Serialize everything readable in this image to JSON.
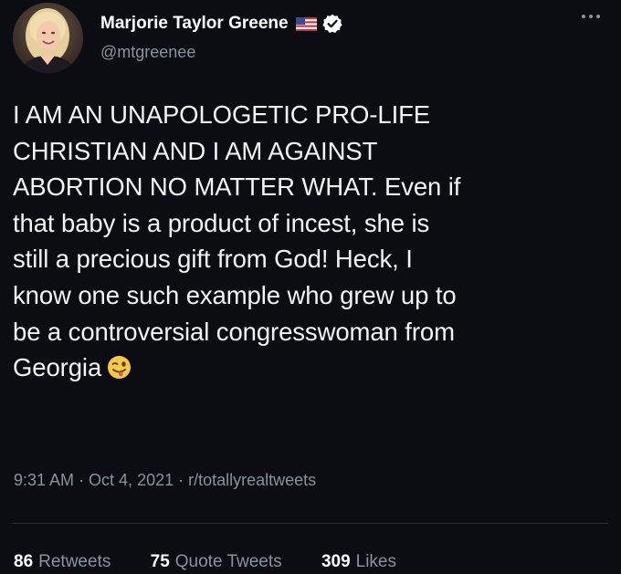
{
  "user": {
    "display_name": "Marjorie Taylor Greene",
    "handle": "@mtgreenee",
    "avatar_icon": "avatar-photo",
    "flag_icon": "us-flag-icon",
    "verified_icon": "verified-badge-icon"
  },
  "tweet": {
    "lines": [
      "I AM AN UNAPOLOGETIC PRO-LIFE",
      "CHRISTIAN AND I AM AGAINST",
      "ABORTION NO MATTER WHAT. Even if",
      "that baby is a product of incest, she is",
      "still a precious gift from God! Heck, I",
      "know one such example who grew up to",
      "be a controversial congresswoman from",
      "Georgia"
    ],
    "emoji_icon": "winking-face-with-tongue-emoji"
  },
  "meta": {
    "time": "9:31 AM",
    "separator": " · ",
    "date": "Oct 4, 2021",
    "source": "r/totallyrealtweets"
  },
  "stats": {
    "retweets_count": "86",
    "retweets_label": "Retweets",
    "quote_count": "75",
    "quote_label": "Quote Tweets",
    "likes_count": "309",
    "likes_label": "Likes"
  },
  "colors": {
    "background": "#0b0d13",
    "text": "#f1f3f5",
    "muted": "#8a929b",
    "divider": "#2a2f36"
  }
}
